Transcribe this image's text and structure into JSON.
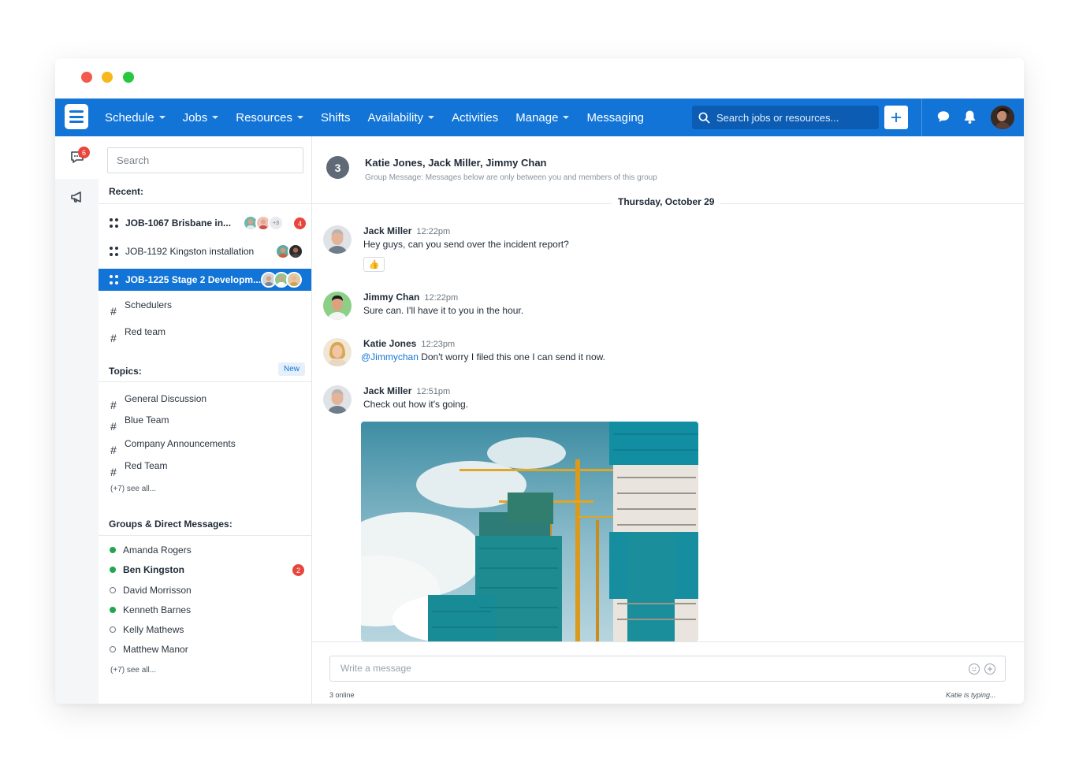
{
  "window": {
    "controls": [
      "close",
      "minimize",
      "maximize"
    ]
  },
  "navbar": {
    "logo_icon": "menu-lines-icon",
    "items": [
      {
        "label": "Schedule",
        "dropdown": true
      },
      {
        "label": "Jobs",
        "dropdown": true
      },
      {
        "label": "Resources",
        "dropdown": true
      },
      {
        "label": "Shifts",
        "dropdown": false
      },
      {
        "label": "Availability",
        "dropdown": true
      },
      {
        "label": "Activities",
        "dropdown": false
      },
      {
        "label": "Manage",
        "dropdown": true
      },
      {
        "label": "Messaging",
        "dropdown": false
      }
    ],
    "search_placeholder": "Search jobs or resources...",
    "add_icon": "plus-icon",
    "chat_icon": "chat-bubble-icon",
    "bell_icon": "bell-icon",
    "accent_color": "#1274d6"
  },
  "rail": {
    "messages_badge": "6",
    "messages_icon": "messages-icon",
    "announcements_icon": "megaphone-icon"
  },
  "sidebar": {
    "search_placeholder": "Search",
    "recent_title": "Recent:",
    "recent_jobs": [
      {
        "label": "JOB-1067 Brisbane in...",
        "bold": true,
        "active": false,
        "extra_count": "+3",
        "badge": "4"
      },
      {
        "label": "JOB-1192 Kingston installation",
        "bold": false,
        "active": false,
        "extra_count": "",
        "badge": ""
      },
      {
        "label": "JOB-1225 Stage 2 Developm...",
        "bold": true,
        "active": true,
        "extra_count": "",
        "badge": ""
      }
    ],
    "recent_channels": [
      "Schedulers",
      "Red team"
    ],
    "topics_title": "Topics:",
    "topics_new": "New",
    "topics": [
      "General Discussion",
      "Blue Team",
      "Company Announcements",
      "Red Team"
    ],
    "topics_see_all": "(+7) see all...",
    "groups_title": "Groups & Direct Messages:",
    "direct_messages": [
      {
        "name": "Amanda Rogers",
        "online": true,
        "bold": false,
        "badge": ""
      },
      {
        "name": "Ben Kingston",
        "online": true,
        "bold": true,
        "badge": "2"
      },
      {
        "name": "David Morrisson",
        "online": false,
        "bold": false,
        "badge": ""
      },
      {
        "name": "Kenneth Barnes",
        "online": true,
        "bold": false,
        "badge": ""
      },
      {
        "name": "Kelly Mathews",
        "online": false,
        "bold": false,
        "badge": ""
      },
      {
        "name": "Matthew Manor",
        "online": false,
        "bold": false,
        "badge": ""
      }
    ],
    "groups_see_all": "(+7) see all..."
  },
  "conversation": {
    "member_count": "3",
    "title": "Katie Jones, Jack Miller, Jimmy Chan",
    "subtitle": "Group Message: Messages below are only between you and members of this group",
    "date_separator": "Thursday, October 29",
    "messages": [
      {
        "author": "Jack Miller",
        "time": "12:22pm",
        "mention": "",
        "text": "Hey guys, can you send over the incident report?",
        "reaction": "👍"
      },
      {
        "author": "Jimmy Chan",
        "time": "12:22pm",
        "mention": "",
        "text": "Sure can. I'll have it to you in the hour.",
        "reaction": ""
      },
      {
        "author": "Katie Jones",
        "time": "12:23pm",
        "mention": "@Jimmychan",
        "text": " Don't worry I filed this one I can send it now.",
        "reaction": ""
      },
      {
        "author": "Jack Miller",
        "time": "12:51pm",
        "mention": "",
        "text": "Check out how it's going.",
        "reaction": ""
      }
    ],
    "attachment": "construction-site-photo",
    "composer_placeholder": "Write a message",
    "emoji_icon": "smiley-icon",
    "attach_icon": "plus-circle-icon",
    "online_status": "3 online",
    "typing_status": "Katie is typing..."
  }
}
